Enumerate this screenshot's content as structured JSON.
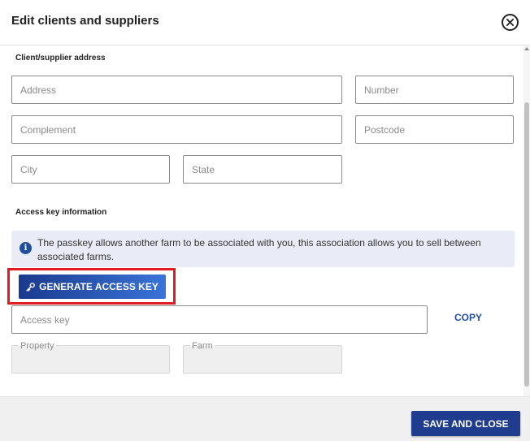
{
  "header": {
    "title": "Edit clients and suppliers",
    "close_icon": "close-circle-icon"
  },
  "address_section": {
    "title": "Client/supplier address",
    "address_placeholder": "Address",
    "number_placeholder": "Number",
    "complement_placeholder": "Complement",
    "postcode_placeholder": "Postcode",
    "city_placeholder": "City",
    "state_placeholder": "State"
  },
  "access_section": {
    "title": "Access key information",
    "info_icon": "info-icon",
    "info_text": "The passkey allows another farm to be associated with you, this association allows you to sell between associated farms.",
    "generate_label": "GENERATE ACCESS KEY",
    "generate_icon": "key-icon",
    "access_key_placeholder": "Access key",
    "copy_label": "COPY",
    "property_label": "Property",
    "farm_label": "Farm"
  },
  "footer": {
    "save_label": "SAVE AND CLOSE"
  },
  "colors": {
    "accent": "#1f4e9c",
    "button_primary": "#1f3c8f",
    "highlight": "#e01b24",
    "info_bg": "#e9ecf6"
  }
}
